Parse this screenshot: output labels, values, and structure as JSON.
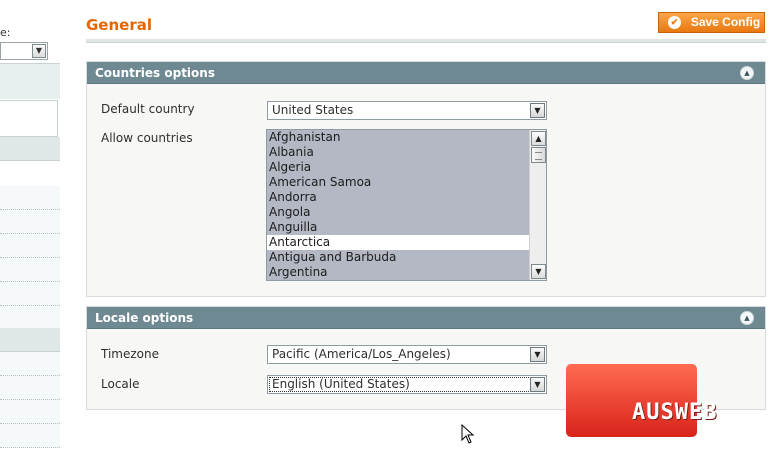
{
  "sidebar": {
    "label_fragment": "e:",
    "select_value": ""
  },
  "header": {
    "title": "General",
    "save_button": "Save Config",
    "save_icon": "check-circle-icon"
  },
  "countries_options": {
    "title": "Countries options",
    "collapse_icon": "chevron-up-icon",
    "default_country": {
      "label": "Default country",
      "value": "United States"
    },
    "allow_countries": {
      "label": "Allow countries",
      "options": [
        {
          "name": "Afghanistan",
          "selected": true
        },
        {
          "name": "Albania",
          "selected": true
        },
        {
          "name": "Algeria",
          "selected": true
        },
        {
          "name": "American Samoa",
          "selected": true
        },
        {
          "name": "Andorra",
          "selected": true
        },
        {
          "name": "Angola",
          "selected": true
        },
        {
          "name": "Anguilla",
          "selected": true
        },
        {
          "name": "Antarctica",
          "selected": false
        },
        {
          "name": "Antigua and Barbuda",
          "selected": true
        },
        {
          "name": "Argentina",
          "selected": true
        }
      ]
    }
  },
  "locale_options": {
    "title": "Locale options",
    "collapse_icon": "chevron-up-icon",
    "timezone": {
      "label": "Timezone",
      "value": "Pacific (America/Los_Angeles)"
    },
    "locale": {
      "label": "Locale",
      "value": "English (United States)"
    }
  },
  "watermark": {
    "text": "AUSWEB"
  },
  "colors": {
    "title_orange": "#e26703",
    "button_orange": "#f38a22",
    "fieldset_header": "#6f8992",
    "selected_option": "#b4b8c4",
    "watermark_red": "#e8362a"
  }
}
